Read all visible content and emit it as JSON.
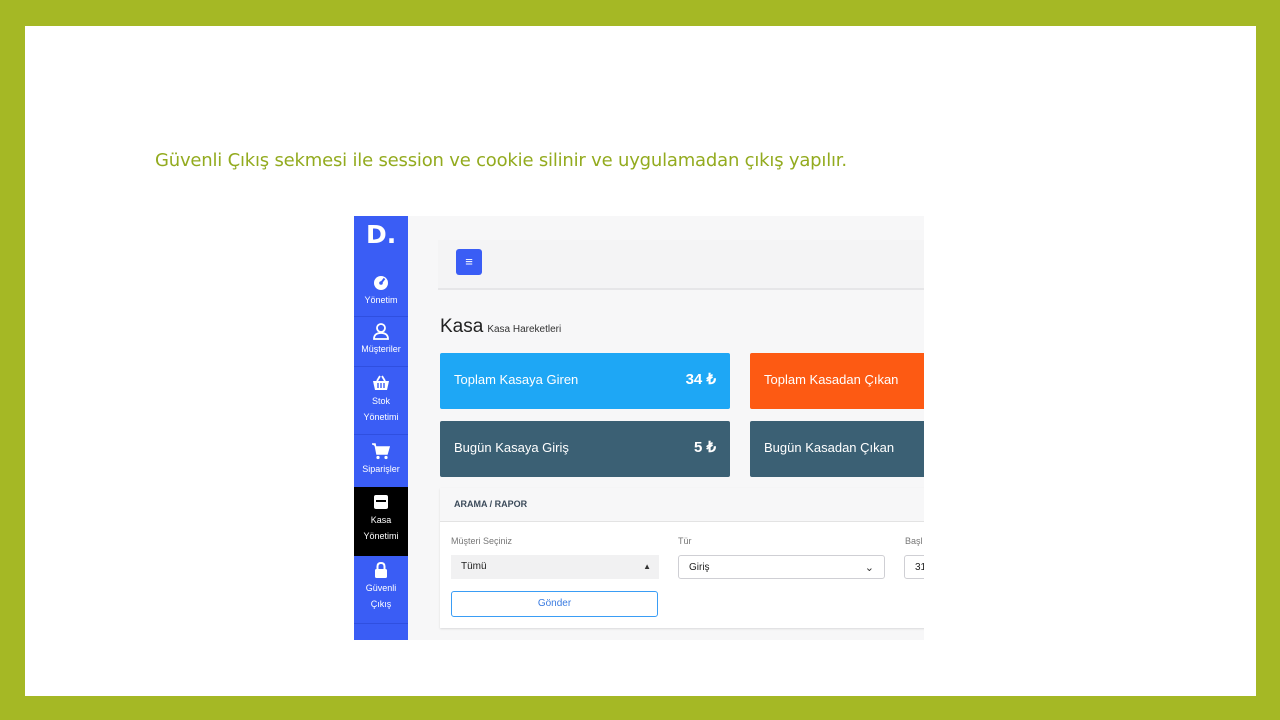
{
  "caption": "Güvenli Çıkış sekmesi ile session ve cookie silinir ve uygulamadan çıkış yapılır.",
  "app": {
    "logo": "D.",
    "sidebar": {
      "items": [
        {
          "label": "Yönetim",
          "icon": "dashboard-icon"
        },
        {
          "label": "Müşteriler",
          "icon": "user-icon"
        },
        {
          "label_line1": "Stok",
          "label_line2": "Yönetimi",
          "icon": "basket-icon"
        },
        {
          "label": "Siparişler",
          "icon": "cart-icon"
        },
        {
          "label_line1": "Kasa",
          "label_line2": "Yönetimi",
          "icon": "cash-register-icon",
          "active": true
        },
        {
          "label_line1": "Güvenli",
          "label_line2": "Çıkış",
          "icon": "lock-icon"
        }
      ]
    },
    "topbar": {
      "menu_icon": "hamburger-icon",
      "menu_glyph": "≡"
    },
    "page": {
      "title": "Kasa",
      "subtitle": "Kasa Hareketleri"
    },
    "stats": [
      {
        "label": "Toplam Kasaya Giren",
        "value": "34 ₺",
        "color": "#1ea7f5"
      },
      {
        "label": "Toplam Kasadan Çıkan",
        "value": "",
        "color": "#fd5a13"
      },
      {
        "label": "Bugün Kasaya Giriş",
        "value": "5 ₺",
        "color": "#3b6074"
      },
      {
        "label": "Bugün Kasadan Çıkan",
        "value": "",
        "color": "#3b6074"
      }
    ],
    "search_panel": {
      "title": "ARAMA / RAPOR",
      "customer_label": "Müşteri Seçiniz",
      "customer_value": "Tümü",
      "type_label": "Tür",
      "type_value": "Giriş",
      "start_label": "Başl",
      "start_value": "31",
      "submit_label": "Gönder"
    },
    "colors": {
      "sidebar": "#3a5df5",
      "active_item": "#000000",
      "accent": "#3a5df5"
    }
  },
  "slide_colors": {
    "frame": "#a5b825",
    "caption": "#93ab1f"
  }
}
